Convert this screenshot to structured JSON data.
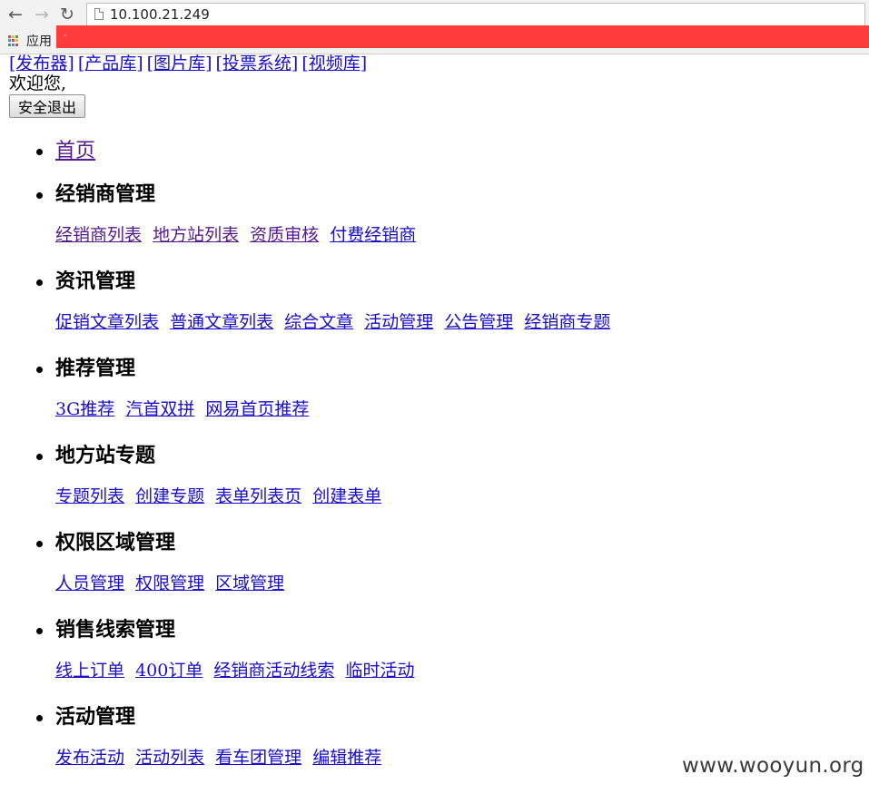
{
  "browser": {
    "url": "10.100.21.249",
    "bookmarks_apps_label": "应用",
    "redaction_mark": "-"
  },
  "top_nav": [
    {
      "label": "[发布器]"
    },
    {
      "label": "[产品库]"
    },
    {
      "label": "[图片库]"
    },
    {
      "label": "[投票系统]"
    },
    {
      "label": "[视频库]"
    }
  ],
  "welcome_text": "欢迎您,",
  "logout_label": "安全退出",
  "menu": [
    {
      "heading": "首页",
      "is_link": true,
      "links": []
    },
    {
      "heading": "经销商管理",
      "links": [
        {
          "label": "经销商列表",
          "visited": true
        },
        {
          "label": "地方站列表",
          "visited": true
        },
        {
          "label": "资质审核",
          "visited": true
        },
        {
          "label": "付费经销商",
          "visited": false
        }
      ]
    },
    {
      "heading": "资讯管理",
      "links": [
        {
          "label": "促销文章列表"
        },
        {
          "label": "普通文章列表"
        },
        {
          "label": "综合文章"
        },
        {
          "label": "活动管理"
        },
        {
          "label": "公告管理"
        },
        {
          "label": "经销商专题"
        }
      ]
    },
    {
      "heading": "推荐管理",
      "links": [
        {
          "label": "3G推荐"
        },
        {
          "label": "汽首双拼"
        },
        {
          "label": "网易首页推荐"
        }
      ]
    },
    {
      "heading": "地方站专题",
      "links": [
        {
          "label": "专题列表"
        },
        {
          "label": "创建专题"
        },
        {
          "label": "表单列表页"
        },
        {
          "label": "创建表单"
        }
      ]
    },
    {
      "heading": "权限区域管理",
      "links": [
        {
          "label": "人员管理"
        },
        {
          "label": "权限管理"
        },
        {
          "label": "区域管理"
        }
      ]
    },
    {
      "heading": "销售线索管理",
      "links": [
        {
          "label": "线上订单"
        },
        {
          "label": "400订单"
        },
        {
          "label": "经销商活动线索"
        },
        {
          "label": "临时活动"
        }
      ]
    },
    {
      "heading": "活动管理",
      "links": [
        {
          "label": "发布活动"
        },
        {
          "label": "活动列表"
        },
        {
          "label": "看车团管理"
        },
        {
          "label": "编辑推荐"
        }
      ]
    }
  ],
  "watermark": "www.wooyun.org",
  "colors": {
    "link": "#1a0dcc",
    "visited_link": "#551a8b",
    "redaction": "#ff3b3b"
  }
}
